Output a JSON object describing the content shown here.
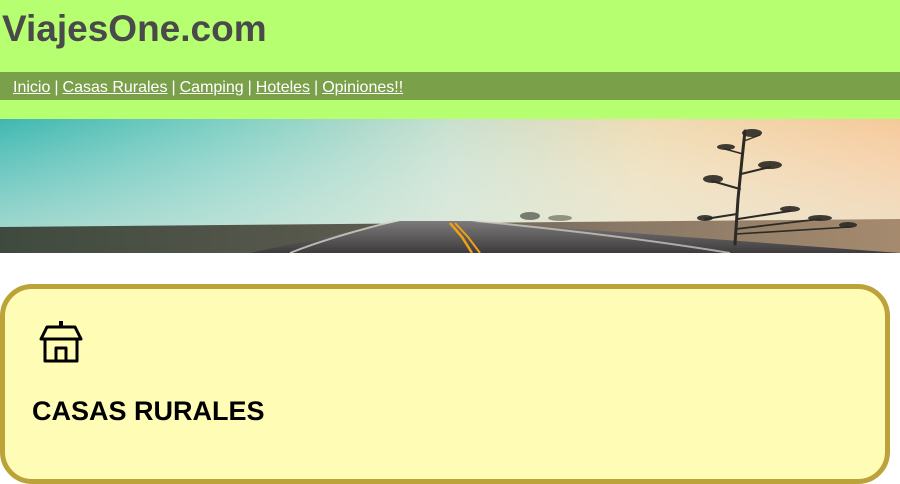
{
  "site": {
    "title": "ViajesOne.com"
  },
  "nav": {
    "items": [
      {
        "label": "Inicio"
      },
      {
        "label": "Casas Rurales"
      },
      {
        "label": "Camping"
      },
      {
        "label": "Hoteles"
      },
      {
        "label": "Opiniones!!"
      }
    ],
    "separator": "|"
  },
  "banner": {
    "icon": "road-landscape-image"
  },
  "section": {
    "icon": "house-icon",
    "title": "CASAS RURALES"
  },
  "colors": {
    "header_bg": "#b6ff70",
    "nav_bg": "#7aa04a",
    "box_bg": "#fffcb6",
    "box_border": "#bba33a"
  }
}
